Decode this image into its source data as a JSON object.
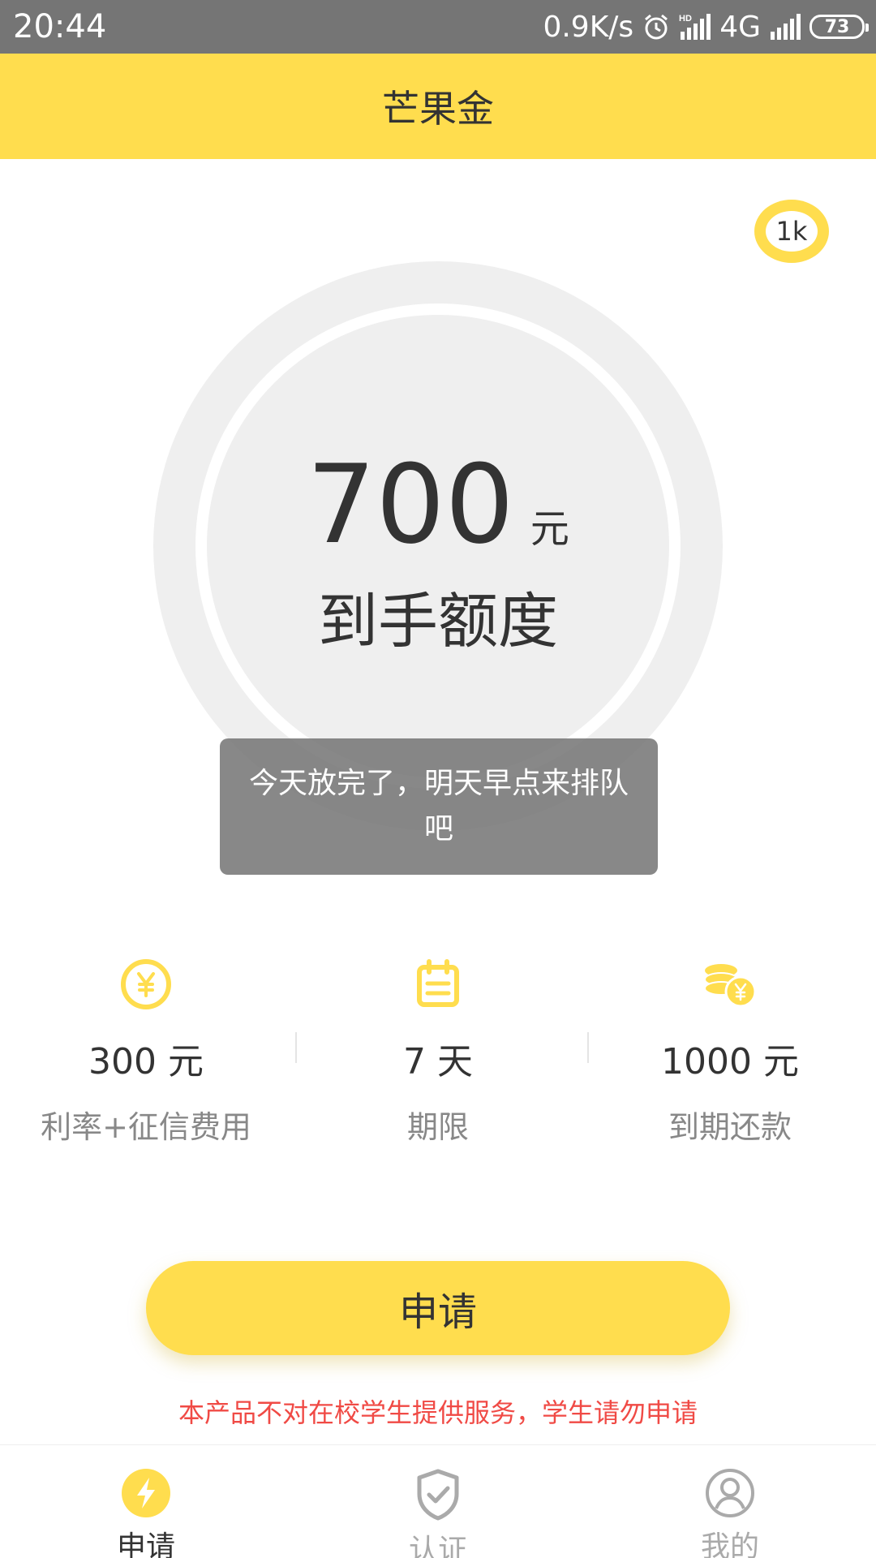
{
  "status_bar": {
    "time": "20:44",
    "network_speed": "0.9K/s",
    "network_type": "4G",
    "hd_label": "HD",
    "battery": "73"
  },
  "app_bar": {
    "title": "芒果金"
  },
  "badge": {
    "label": "1k"
  },
  "amount": {
    "value": "700",
    "unit": "元",
    "label": "到手额度"
  },
  "toast": {
    "message": "今天放完了，明天早点来排队吧"
  },
  "stats": [
    {
      "icon": "yen-coin-icon",
      "value": "300 元",
      "label": "利率+征信费用"
    },
    {
      "icon": "calendar-icon",
      "value": "7 天",
      "label": "期限"
    },
    {
      "icon": "coins-stack-icon",
      "value": "1000 元",
      "label": "到期还款"
    }
  ],
  "apply_button": {
    "label": "申请"
  },
  "notice": "本产品不对在校学生提供服务，学生请勿申请",
  "bottom_nav": [
    {
      "icon": "lightning-icon",
      "label": "申请",
      "active": true
    },
    {
      "icon": "shield-check-icon",
      "label": "认证",
      "active": false
    },
    {
      "icon": "user-icon",
      "label": "我的",
      "active": false
    }
  ],
  "colors": {
    "brand_yellow": "#ffdd4e",
    "notice_red": "#f04a45",
    "status_bar_gray": "#757575"
  }
}
